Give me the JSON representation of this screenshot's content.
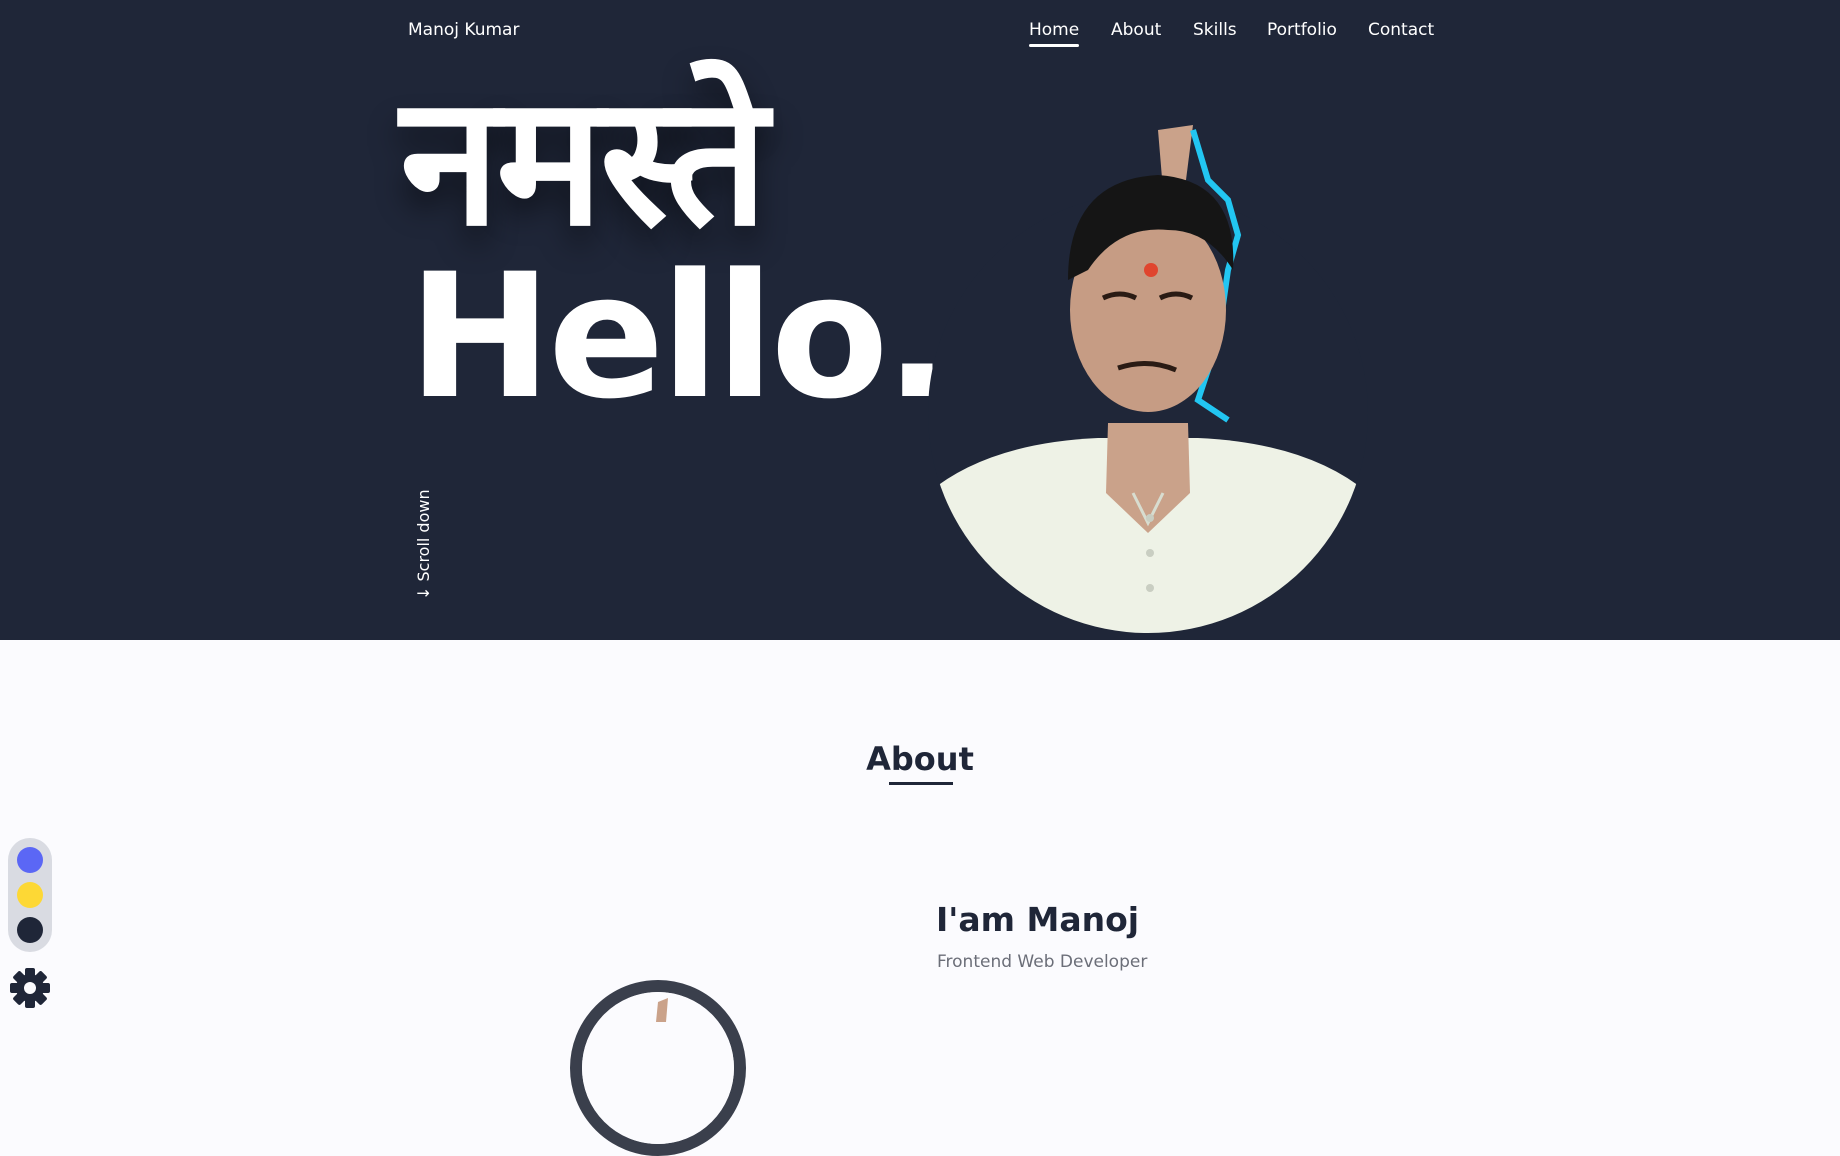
{
  "header": {
    "brand": "Manoj Kumar",
    "nav": [
      {
        "label": "Home",
        "active": true
      },
      {
        "label": "About",
        "active": false
      },
      {
        "label": "Skills",
        "active": false
      },
      {
        "label": "Portfolio",
        "active": false
      },
      {
        "label": "Contact",
        "active": false
      }
    ]
  },
  "hero": {
    "greeting_hindi": "नमस्ते",
    "greeting_english": "Hello.",
    "scroll_label": "↓ Scroll down"
  },
  "about": {
    "title": "About",
    "intro_title": "I'am Manoj",
    "intro_subtitle": "Frontend Web Developer"
  },
  "theme": {
    "swatches": [
      {
        "name": "blue",
        "color": "#5b67f5"
      },
      {
        "name": "yellow",
        "color": "#fdd835"
      },
      {
        "name": "dark",
        "color": "#1f2638"
      }
    ],
    "settings_icon": "gear-icon"
  },
  "colors": {
    "hero_bg": "#1f2638",
    "page_bg": "#fbfbfe",
    "text_dark": "#1f2638",
    "text_muted": "#6b6e78"
  }
}
